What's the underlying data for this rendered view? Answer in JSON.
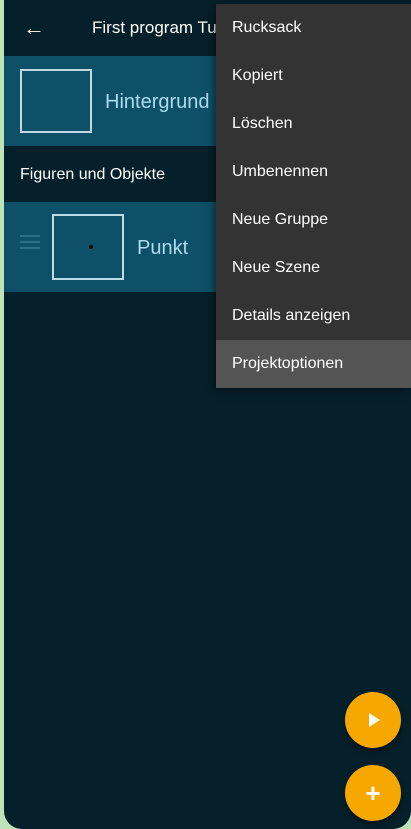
{
  "toolbar": {
    "title": "First program Tu",
    "back_icon": "arrow-left-icon"
  },
  "scene_list": {
    "background": {
      "label": "Hintergrund"
    },
    "section_title": "Figuren und Objekte",
    "sprites": [
      {
        "label": "Punkt"
      }
    ]
  },
  "menu": {
    "items": [
      {
        "label": "Rucksack"
      },
      {
        "label": "Kopiert"
      },
      {
        "label": "Löschen"
      },
      {
        "label": "Umbenennen"
      },
      {
        "label": "Neue Gruppe"
      },
      {
        "label": "Neue Szene"
      },
      {
        "label": "Details anzeigen"
      },
      {
        "label": "Projektoptionen",
        "highlighted": true
      }
    ]
  },
  "fabs": {
    "play_icon": "play-icon",
    "add_icon": "plus-icon"
  },
  "colors": {
    "background": "#05202a",
    "row": "#0f5069",
    "menu": "#333333",
    "menu_highlight": "#545454",
    "accent": "#f6a800"
  }
}
